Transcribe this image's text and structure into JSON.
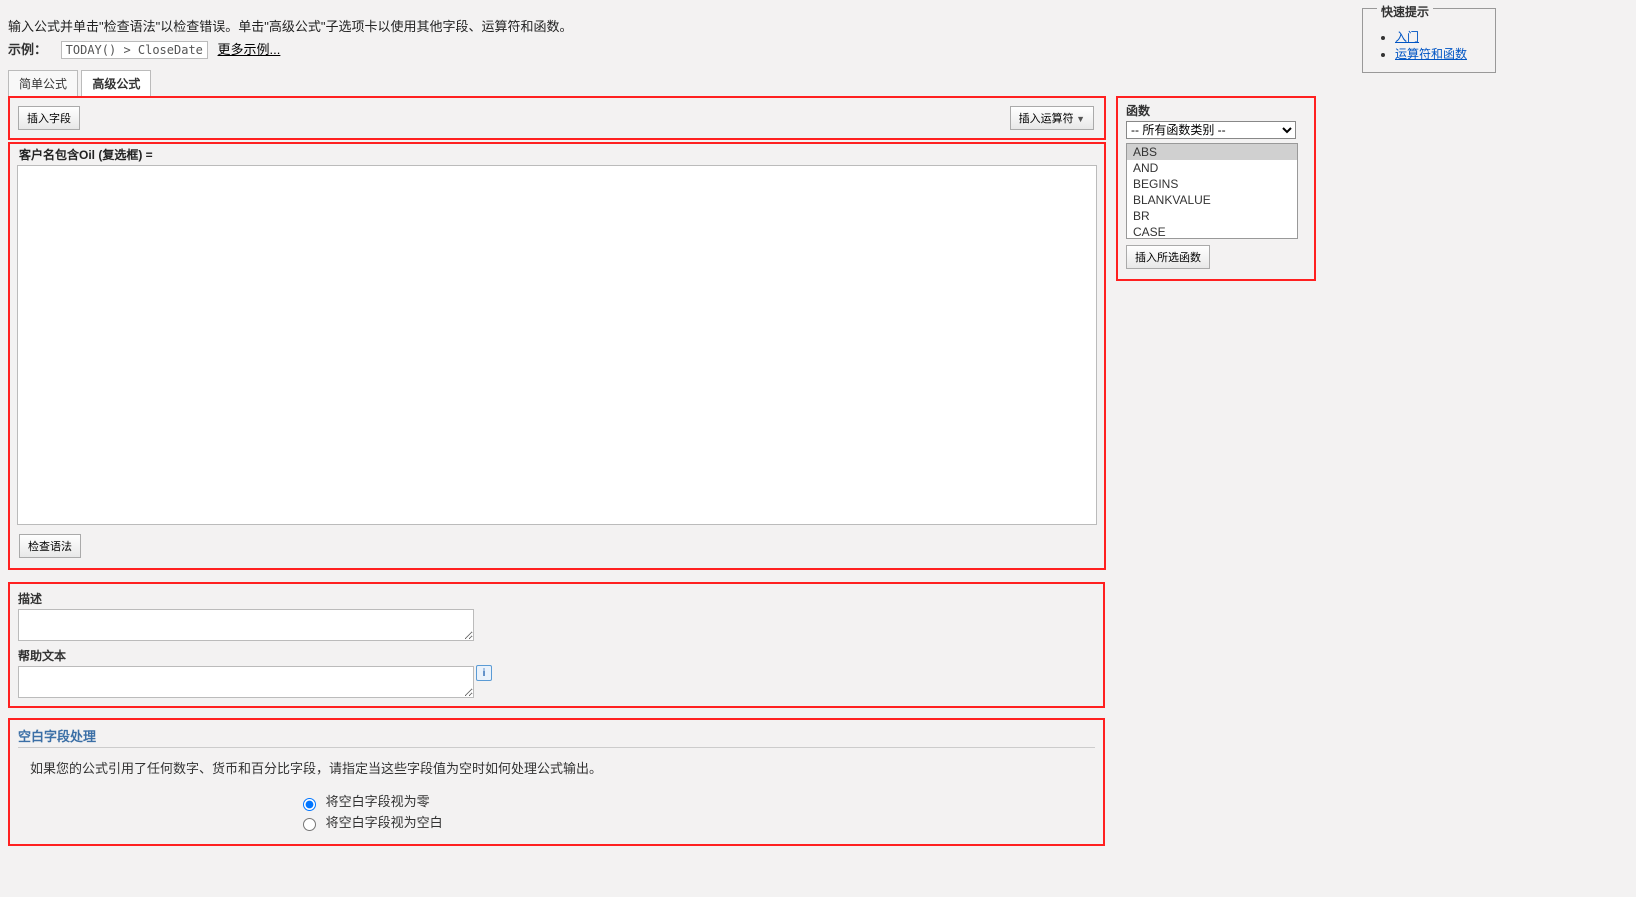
{
  "instructions": "输入公式并单击\"检查语法\"以检查错误。单击\"高级公式\"子选项卡以使用其他字段、运算符和函数。",
  "example": {
    "label": "示例：",
    "code": "TODAY() > CloseDate",
    "more_link": "更多示例..."
  },
  "quick_tips": {
    "title": "快速提示",
    "links": [
      "入门",
      "运算符和函数"
    ]
  },
  "tabs": {
    "simple": "简单公式",
    "advanced": "高级公式"
  },
  "toolbar": {
    "insert_field": "插入字段",
    "insert_operator": "插入运算符"
  },
  "editor": {
    "label": "客户名包含Oil (复选框) =",
    "value": "",
    "check_syntax": "检查语法"
  },
  "functions": {
    "title": "函数",
    "category_selected": "-- 所有函数类别 --",
    "list": [
      "ABS",
      "AND",
      "BEGINS",
      "BLANKVALUE",
      "BR",
      "CASE"
    ],
    "insert_selected": "插入所选函数"
  },
  "description": {
    "label": "描述",
    "value": ""
  },
  "help_text": {
    "label": "帮助文本",
    "value": ""
  },
  "blank_handling": {
    "title": "空白字段处理",
    "description": "如果您的公式引用了任何数字、货币和百分比字段，请指定当这些字段值为空时如何处理公式输出。",
    "option_zero": "将空白字段视为零",
    "option_blank": "将空白字段视为空白"
  }
}
